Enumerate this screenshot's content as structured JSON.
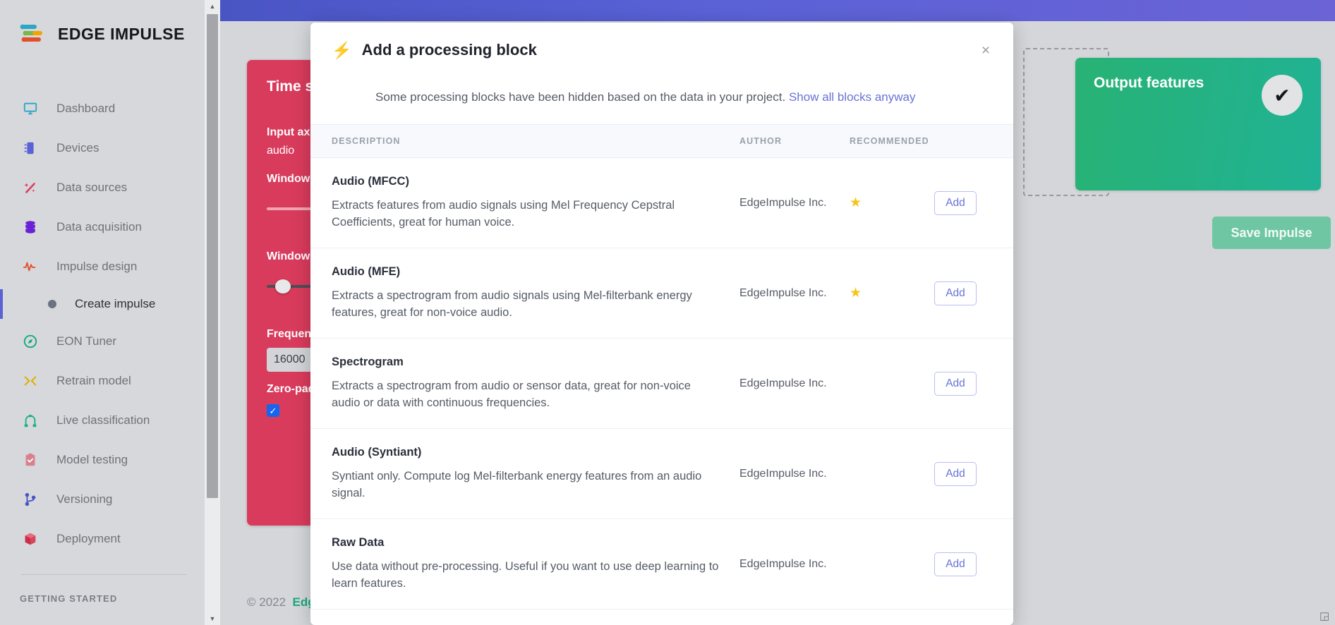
{
  "brand": {
    "name": "EDGE IMPULSE"
  },
  "sidebar": {
    "items": [
      {
        "label": "Dashboard",
        "icon": "monitor-icon"
      },
      {
        "label": "Devices",
        "icon": "chip-icon"
      },
      {
        "label": "Data sources",
        "icon": "wand-icon"
      },
      {
        "label": "Data acquisition",
        "icon": "database-icon"
      },
      {
        "label": "Impulse design",
        "icon": "pulse-icon"
      }
    ],
    "sub_item": {
      "label": "Create impulse",
      "active": true
    },
    "items2": [
      {
        "label": "EON Tuner",
        "icon": "compass-icon"
      },
      {
        "label": "Retrain model",
        "icon": "shuffle-icon"
      },
      {
        "label": "Live classification",
        "icon": "network-icon"
      },
      {
        "label": "Model testing",
        "icon": "clipboard-check-icon"
      },
      {
        "label": "Versioning",
        "icon": "git-branch-icon"
      },
      {
        "label": "Deployment",
        "icon": "box-icon"
      }
    ],
    "section_label": "GETTING STARTED"
  },
  "time_series_card": {
    "title": "Time series data",
    "input_axes_label": "Input axes",
    "input_axes_value": "audio",
    "window_size_label": "Window size",
    "window_increase_label": "Window increase",
    "frequency_label": "Frequency (Hz)",
    "frequency_value": "16000",
    "zero_pad_label": "Zero-pad data",
    "zero_pad_checked": true
  },
  "output_card": {
    "title": "Output features",
    "check_icon": "check-icon"
  },
  "save_button": {
    "label": "Save Impulse"
  },
  "footer": {
    "copyright": "© 2022",
    "link": "Edge"
  },
  "modal": {
    "title": "Add a processing block",
    "title_icon": "bolt-icon",
    "close_icon": "close-icon",
    "note_text": "Some processing blocks have been hidden based on the data in your project.",
    "note_link": "Show all blocks anyway",
    "columns": {
      "description": "DESCRIPTION",
      "author": "AUTHOR",
      "recommended": "RECOMMENDED"
    },
    "add_label": "Add",
    "star_icon": "star-icon",
    "rows": [
      {
        "name": "Audio (MFCC)",
        "description": "Extracts features from audio signals using Mel Frequency Cepstral Coefficients, great for human voice.",
        "author": "EdgeImpulse Inc.",
        "recommended": true
      },
      {
        "name": "Audio (MFE)",
        "description": "Extracts a spectrogram from audio signals using Mel-filterbank energy features, great for non-voice audio.",
        "author": "EdgeImpulse Inc.",
        "recommended": true
      },
      {
        "name": "Spectrogram",
        "description": "Extracts a spectrogram from audio or sensor data, great for non-voice audio or data with continuous frequencies.",
        "author": "EdgeImpulse Inc.",
        "recommended": false
      },
      {
        "name": "Audio (Syntiant)",
        "description": "Syntiant only. Compute log Mel-filterbank energy features from an audio signal.",
        "author": "EdgeImpulse Inc.",
        "recommended": false
      },
      {
        "name": "Raw Data",
        "description": "Use data without pre-processing. Useful if you want to use deep learning to learn features.",
        "author": "EdgeImpulse Inc.",
        "recommended": false
      }
    ]
  },
  "colors": {
    "accent_purple": "#5a62d6",
    "card_red": "#d93b5c",
    "card_green": "#22b286",
    "star_yellow": "#f5c518",
    "link_blue": "#6873d6"
  }
}
